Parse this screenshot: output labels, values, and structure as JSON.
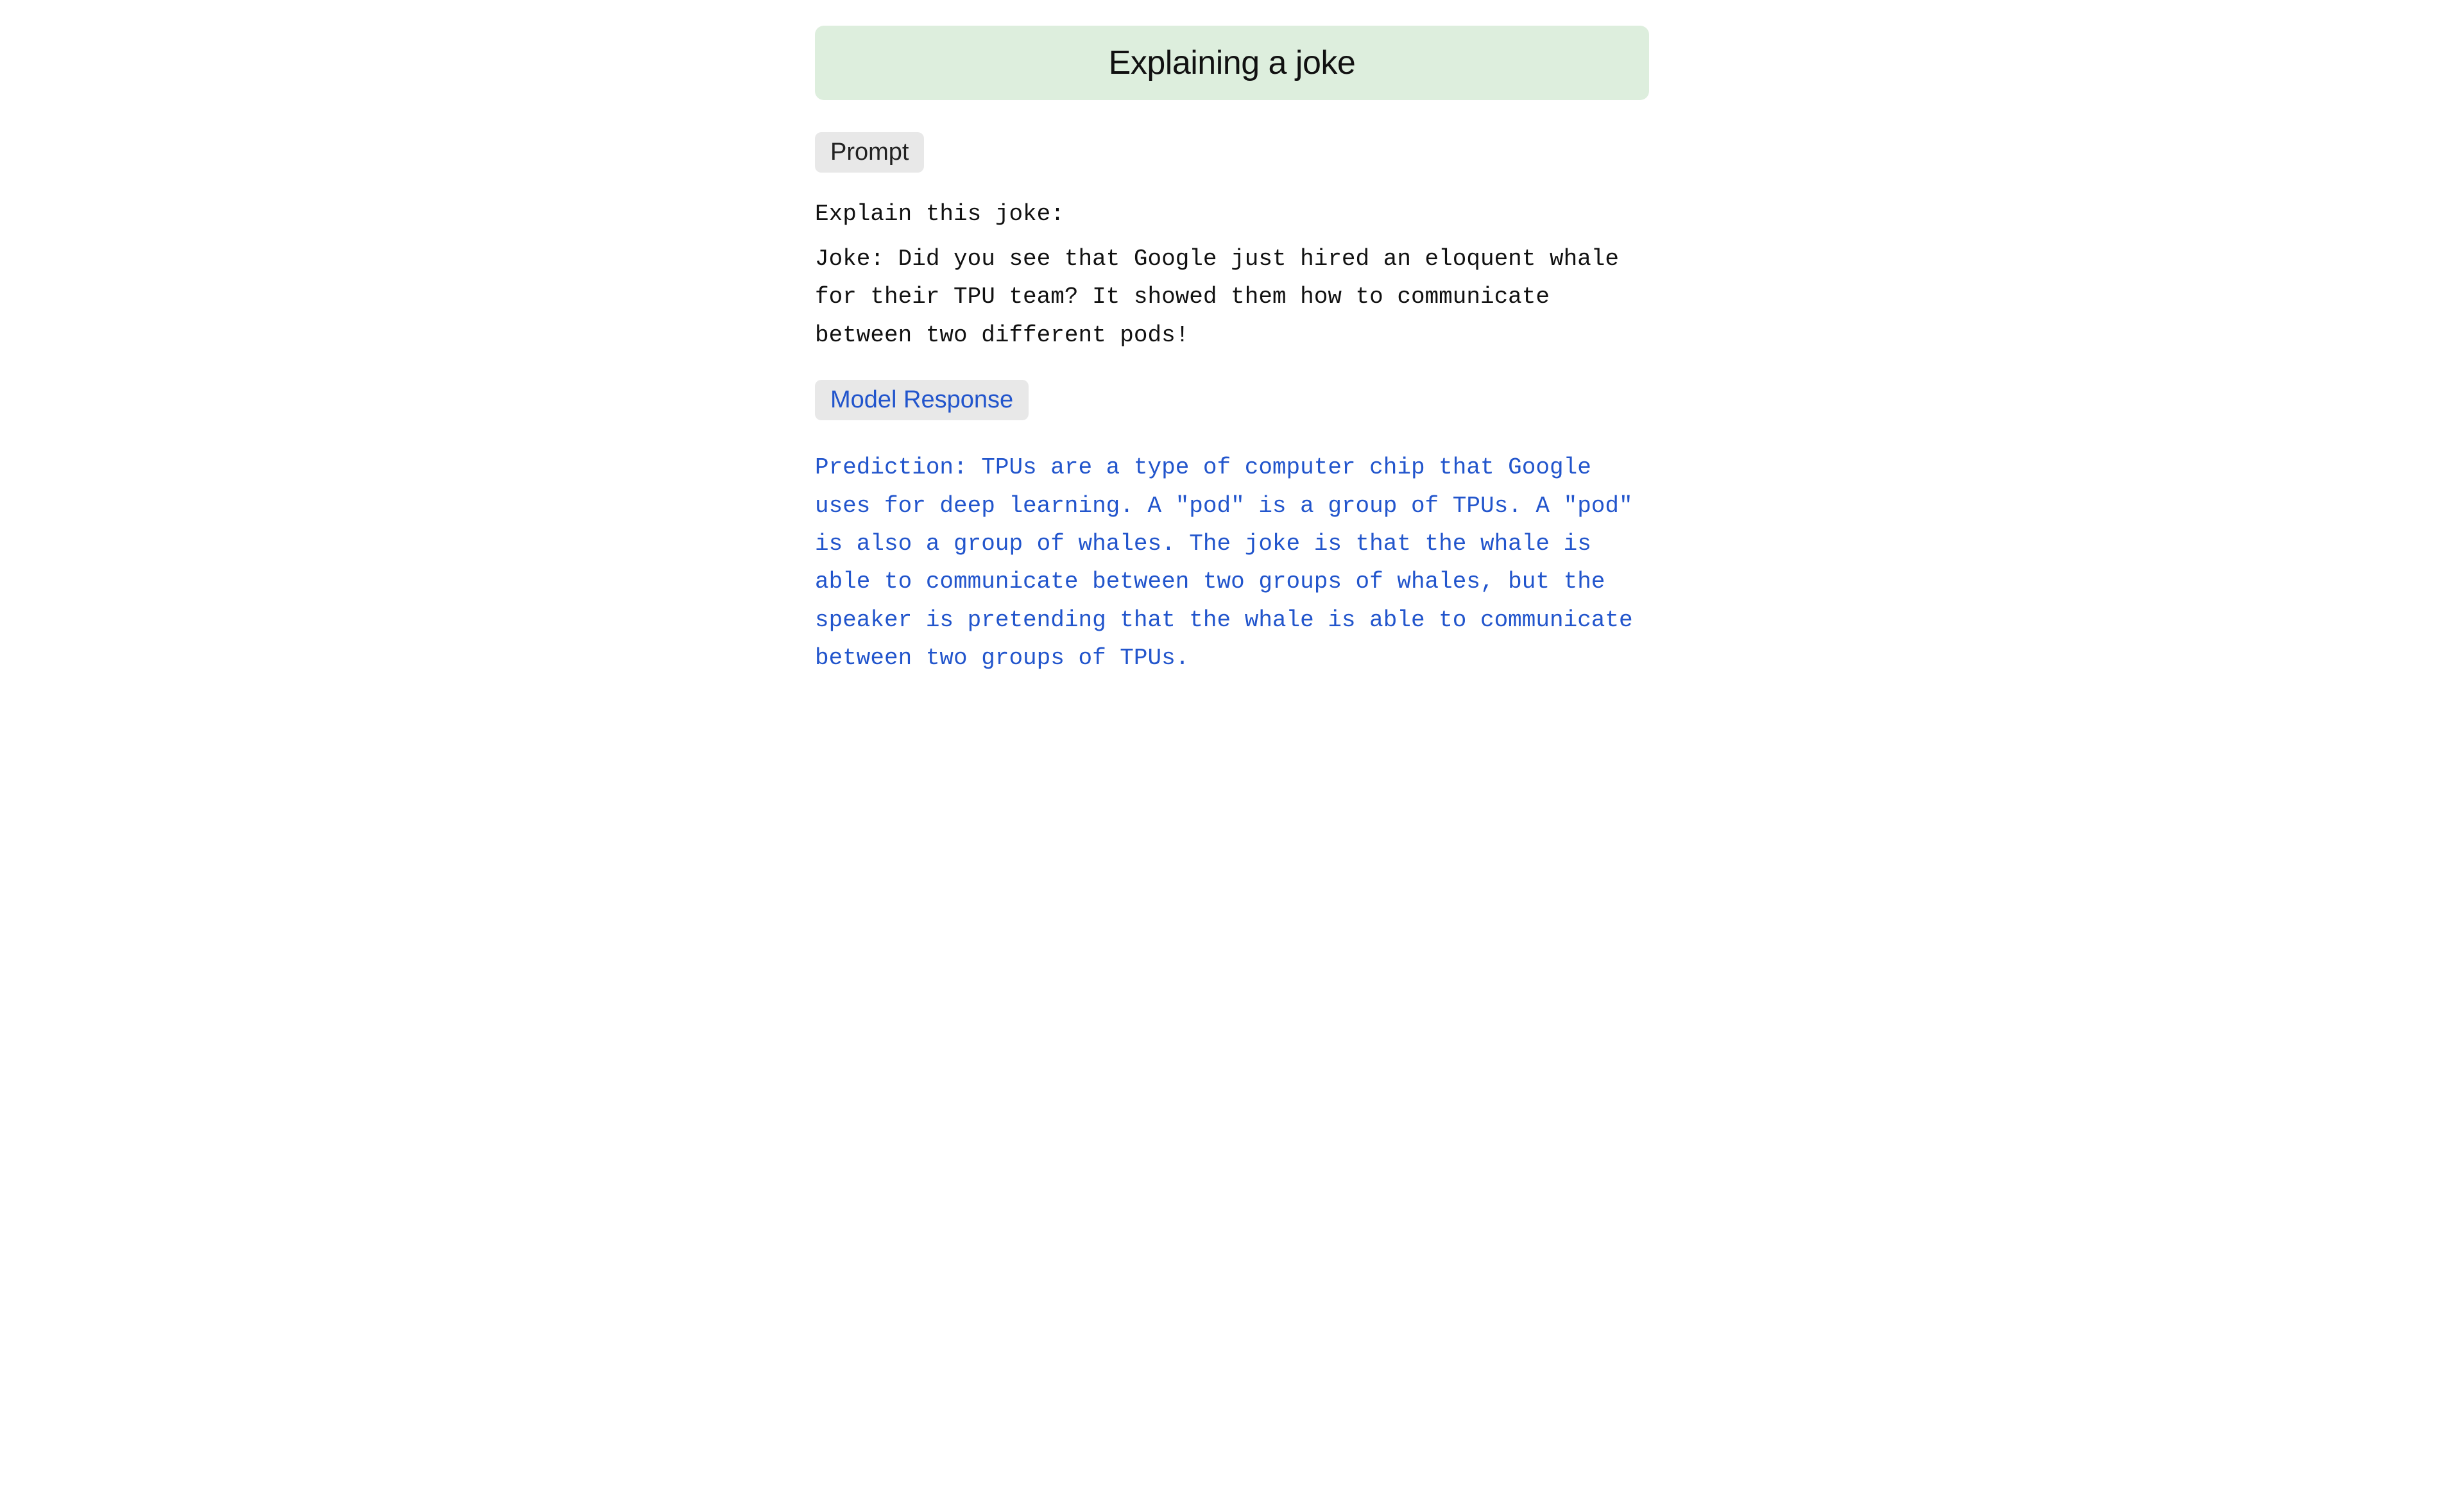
{
  "header": {
    "title": "Explaining a joke",
    "background_color": "#ddeedd"
  },
  "prompt_section": {
    "badge_label": "Prompt",
    "intro_line": "Explain this joke:",
    "joke_text": "Joke: Did you see that Google just hired an eloquent whale for their TPU team? It showed them how to communicate between two different pods!"
  },
  "model_section": {
    "badge_label": "Model Response",
    "badge_color": "#2255cc",
    "response_text": "Prediction: TPUs are a type of computer chip that Google uses for deep learning. A \"pod\" is a group of TPUs. A \"pod\" is also a group of whales. The joke is that the whale is able to communicate between two groups of whales, but the speaker is pretending that the whale is able to communicate between two groups of TPUs."
  }
}
